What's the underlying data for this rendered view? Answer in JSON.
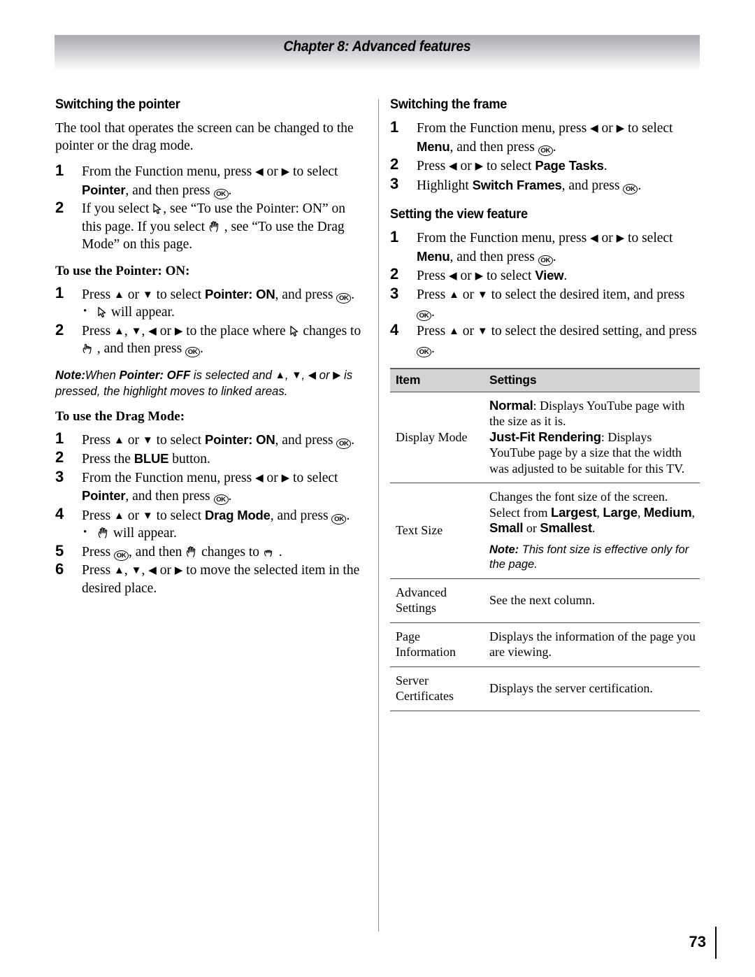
{
  "header": {
    "chapter_title": "Chapter 8: Advanced features"
  },
  "left_column": {
    "section1": {
      "heading": "Switching the pointer",
      "intro": "The tool that operates the screen can be changed to the pointer or the drag mode.",
      "steps": [
        {
          "num": "1",
          "text": "From the Function menu, press ◀ or ▶ to select Pointer, and then press (OK)."
        },
        {
          "num": "2",
          "text": "If you select ↖(pointer-icon), see “To use the Pointer: ON” on this page. If you select (open-hand-icon), see “To use the Drag Mode” on this page."
        }
      ]
    },
    "pointer_on": {
      "heading": "To use the Pointer: ON:",
      "steps": [
        {
          "num": "1",
          "text": "Press ▲ or ▼ to select Pointer: ON, and press (OK).",
          "bullet": "(pointer-icon) will appear."
        },
        {
          "num": "2",
          "text": "Press ▲, ▼, ◀ or ▶ to the place where (pointer-icon) changes to (pointing-hand-icon), and then press (OK)."
        }
      ],
      "note_label": "Note:",
      "note_text_1": "When ",
      "note_bold": "Pointer: OFF",
      "note_text_2": " is selected and ▲, ▼, ◀ or ▶ is pressed, the highlight moves to linked areas."
    },
    "drag_mode": {
      "heading": "To use the Drag Mode:",
      "steps": [
        {
          "num": "1",
          "text": "Press ▲ or ▼ to select Pointer: ON, and press (OK)."
        },
        {
          "num": "2",
          "text": "Press the BLUE button."
        },
        {
          "num": "3",
          "text": "From the Function menu, press ◀ or ▶ to select Pointer, and then press (OK)."
        },
        {
          "num": "4",
          "text": "Press ▲ or ▼ to select Drag Mode, and press (OK).",
          "bullet": "(open-hand-icon) will appear."
        },
        {
          "num": "5",
          "text": "Press (OK), and then (open-hand-icon) changes to (grab-hand-icon)."
        },
        {
          "num": "6",
          "text": "Press ▲, ▼, ◀ or ▶ to move the selected item in the desired place."
        }
      ]
    },
    "labels": {
      "pointer": "Pointer",
      "pointer_on": "Pointer: ON",
      "blue": "BLUE",
      "drag_mode": "Drag Mode",
      "ok": "OK"
    }
  },
  "right_column": {
    "section_frame": {
      "heading": "Switching the frame",
      "steps": [
        {
          "num": "1",
          "text": "From the Function menu, press ◀ or ▶ to select Menu, and then press (OK)."
        },
        {
          "num": "2",
          "text": "Press ◀ or ▶ to select Page Tasks."
        },
        {
          "num": "3",
          "text": "Highlight Switch Frames, and press (OK)."
        }
      ]
    },
    "section_view": {
      "heading": "Setting the view feature",
      "steps": [
        {
          "num": "1",
          "text": "From the Function menu, press ◀ or ▶ to select Menu, and then press (OK)."
        },
        {
          "num": "2",
          "text": "Press ◀ or ▶ to select View."
        },
        {
          "num": "3",
          "text": "Press ▲ or ▼ to select the desired item, and press (OK)."
        },
        {
          "num": "4",
          "text": "Press ▲ or ▼ to select the desired setting, and press (OK)."
        }
      ]
    },
    "labels": {
      "menu": "Menu",
      "page_tasks": "Page Tasks",
      "switch_frames": "Switch Frames",
      "view": "View"
    },
    "table": {
      "headers": [
        "Item",
        "Settings"
      ],
      "rows": [
        {
          "item": "Display Mode",
          "opt1_name": "Normal",
          "opt1_desc": ": Displays YouTube page with the size as it is.",
          "opt2_name": "Just-Fit Rendering",
          "opt2_desc": ": Displays YouTube page by a size that the width was adjusted to be suitable for this TV."
        },
        {
          "item": "Text Size",
          "desc_a": "Changes the font size of the screen. Select from ",
          "sizes": [
            "Largest",
            "Large",
            "Medium",
            "Small",
            "Smallest"
          ],
          "note_label": "Note:",
          "note_text": " This font size is effective only for the page."
        },
        {
          "item": "Advanced Settings",
          "desc": "See the next column."
        },
        {
          "item": "Page Information",
          "desc": "Displays the information of the page you are viewing."
        },
        {
          "item": "Server Certificates",
          "desc": "Displays the server certification."
        }
      ]
    }
  },
  "footer": {
    "page_number": "73"
  }
}
